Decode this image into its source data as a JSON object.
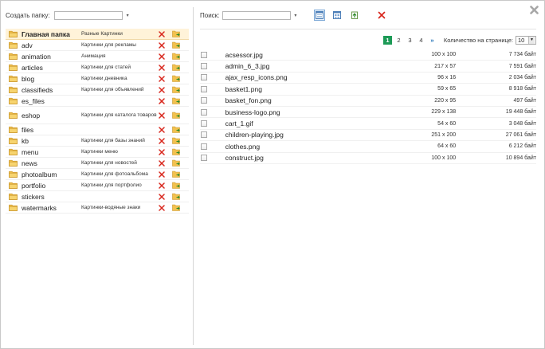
{
  "left": {
    "create_label": "Создать папку:",
    "create_value": "",
    "folders": [
      {
        "name": "Главная папка",
        "desc": "Разные Картинки",
        "selected": true
      },
      {
        "name": "adv",
        "desc": "Картинки для рекламы"
      },
      {
        "name": "animation",
        "desc": "Анимация"
      },
      {
        "name": "articles",
        "desc": "Картинки для статей"
      },
      {
        "name": "blog",
        "desc": "Картинки дневника"
      },
      {
        "name": "classifieds",
        "desc": "Картинки для объявлений"
      },
      {
        "name": "es_files",
        "desc": ""
      },
      {
        "name": "eshop",
        "desc": "Картинки для каталога товаров"
      },
      {
        "name": "files",
        "desc": ""
      },
      {
        "name": "kb",
        "desc": "Картинки для базы знаний"
      },
      {
        "name": "menu",
        "desc": "Картинки меню"
      },
      {
        "name": "news",
        "desc": "Картинки для новостей"
      },
      {
        "name": "photoalbum",
        "desc": "Картинки для фотоальбома"
      },
      {
        "name": "portfolio",
        "desc": "Картинки для портфолио"
      },
      {
        "name": "stickers",
        "desc": ""
      },
      {
        "name": "watermarks",
        "desc": "Картинки-водяные знаки"
      }
    ]
  },
  "right": {
    "search_label": "Поиск:",
    "search_value": "",
    "pages": [
      "1",
      "2",
      "3",
      "4"
    ],
    "current_page": "1",
    "next_label": "»",
    "per_page_label": "Количество на странице:",
    "per_page_value": "10",
    "files": [
      {
        "name": "acsessor.jpg",
        "dims": "100 x 100",
        "size": "7 734 байт"
      },
      {
        "name": "admin_6_3.jpg",
        "dims": "217 x 57",
        "size": "7 591 байт"
      },
      {
        "name": "ajax_resp_icons.png",
        "dims": "96 x 16",
        "size": "2 034 байт"
      },
      {
        "name": "basket1.png",
        "dims": "59 x 65",
        "size": "8 918 байт"
      },
      {
        "name": "basket_fon.png",
        "dims": "220 x 95",
        "size": "497 байт"
      },
      {
        "name": "business-logo.png",
        "dims": "229 x 138",
        "size": "19 448 байт"
      },
      {
        "name": "cart_1.gif",
        "dims": "54 x 60",
        "size": "3 048 байт"
      },
      {
        "name": "children-playing.jpg",
        "dims": "251 x 200",
        "size": "27 061 байт"
      },
      {
        "name": "clothes.png",
        "dims": "64 x 60",
        "size": "6 212 байт"
      },
      {
        "name": "construct.jpg",
        "dims": "100 x 100",
        "size": "10 894 байт"
      }
    ]
  },
  "icons": {
    "close": "close-icon",
    "folder": "folder-icon",
    "delete": "delete-icon",
    "select": "select-folder-icon",
    "view_list": "list-view-icon",
    "view_thumbs": "thumbnail-view-icon",
    "upload": "upload-icon"
  },
  "colors": {
    "selected_row": "#fff3d9",
    "current_page": "#1c9a56",
    "delete": "#d8261c",
    "folder": "#f2c14e"
  }
}
